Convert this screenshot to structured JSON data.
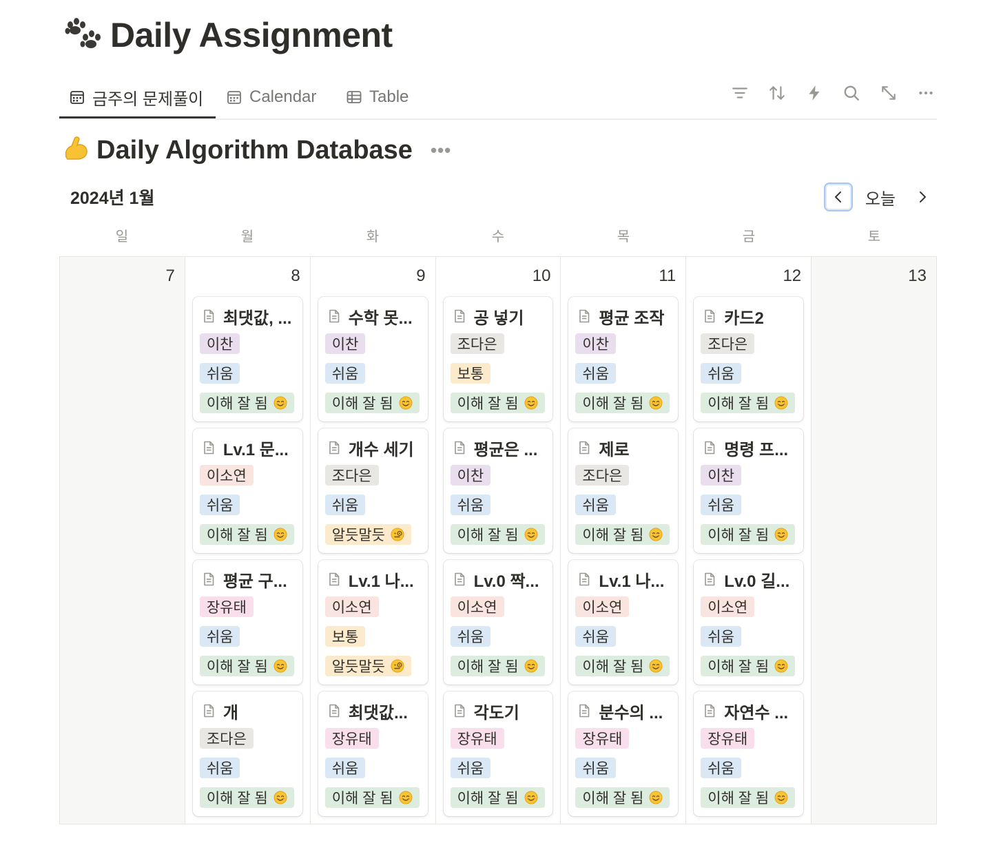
{
  "page": {
    "title": "Daily Assignment",
    "icon": "paw-prints-icon"
  },
  "tabs": [
    {
      "label": "금주의 문제풀이",
      "icon": "calendar-icon",
      "active": true
    },
    {
      "label": "Calendar",
      "icon": "calendar-icon",
      "active": false
    },
    {
      "label": "Table",
      "icon": "table-icon",
      "active": false
    }
  ],
  "toolbar": [
    "filter-icon",
    "sort-icon",
    "automation-lightning-icon",
    "search-icon",
    "expand-icon",
    "more-icon"
  ],
  "database": {
    "title": "Daily Algorithm Database",
    "icon": "flexed-biceps-icon",
    "more": "•••"
  },
  "calendar": {
    "month": "2024년 1월",
    "today_label": "오늘",
    "weekdays": [
      "일",
      "월",
      "화",
      "수",
      "목",
      "금",
      "토"
    ],
    "days": [
      {
        "num": "7",
        "weekend": true,
        "cards": []
      },
      {
        "num": "8",
        "weekend": false,
        "cards": [
          {
            "title": "최댓값, ...",
            "person": "이찬",
            "difficulty": "쉬움",
            "understanding": "이해 잘 됨"
          },
          {
            "title": "Lv.1 문...",
            "person": "이소연",
            "difficulty": "쉬움",
            "understanding": "이해 잘 됨"
          },
          {
            "title": "평균 구...",
            "person": "장유태",
            "difficulty": "쉬움",
            "understanding": "이해 잘 됨"
          },
          {
            "title": "개",
            "person": "조다은",
            "difficulty": "쉬움",
            "understanding": "이해 잘 됨"
          }
        ]
      },
      {
        "num": "9",
        "weekend": false,
        "cards": [
          {
            "title": "수학 못...",
            "person": "이찬",
            "difficulty": "쉬움",
            "understanding": "이해 잘 됨"
          },
          {
            "title": "개수 세기",
            "person": "조다은",
            "difficulty": "쉬움",
            "understanding": "알듯말듯"
          },
          {
            "title": "Lv.1 나...",
            "person": "이소연",
            "difficulty": "보통",
            "understanding": "알듯말듯"
          },
          {
            "title": "최댓값...",
            "person": "장유태",
            "difficulty": "쉬움",
            "understanding": "이해 잘 됨"
          }
        ]
      },
      {
        "num": "10",
        "weekend": false,
        "cards": [
          {
            "title": "공 넣기",
            "person": "조다은",
            "difficulty": "보통",
            "understanding": "이해 잘 됨"
          },
          {
            "title": "평균은 ...",
            "person": "이찬",
            "difficulty": "쉬움",
            "understanding": "이해 잘 됨"
          },
          {
            "title": "Lv.0 짝...",
            "person": "이소연",
            "difficulty": "쉬움",
            "understanding": "이해 잘 됨"
          },
          {
            "title": "각도기",
            "person": "장유태",
            "difficulty": "쉬움",
            "understanding": "이해 잘 됨"
          }
        ]
      },
      {
        "num": "11",
        "weekend": false,
        "cards": [
          {
            "title": "평균 조작",
            "person": "이찬",
            "difficulty": "쉬움",
            "understanding": "이해 잘 됨"
          },
          {
            "title": "제로",
            "person": "조다은",
            "difficulty": "쉬움",
            "understanding": "이해 잘 됨"
          },
          {
            "title": "Lv.1 나...",
            "person": "이소연",
            "difficulty": "쉬움",
            "understanding": "이해 잘 됨"
          },
          {
            "title": "분수의 ...",
            "person": "장유태",
            "difficulty": "쉬움",
            "understanding": "이해 잘 됨"
          }
        ]
      },
      {
        "num": "12",
        "weekend": false,
        "cards": [
          {
            "title": "카드2",
            "person": "조다은",
            "difficulty": "쉬움",
            "understanding": "이해 잘 됨"
          },
          {
            "title": "명령 프...",
            "person": "이찬",
            "difficulty": "쉬움",
            "understanding": "이해 잘 됨"
          },
          {
            "title": "Lv.0 길...",
            "person": "이소연",
            "difficulty": "쉬움",
            "understanding": "이해 잘 됨"
          },
          {
            "title": "자연수 ...",
            "person": "장유태",
            "difficulty": "쉬움",
            "understanding": "이해 잘 됨"
          }
        ]
      },
      {
        "num": "13",
        "weekend": true,
        "cards": []
      }
    ]
  },
  "tag_colors": {
    "이찬": "#e8deee",
    "이소연": "#f9e4df",
    "장유태": "#f9dfeb",
    "조다은": "#e8e7e4",
    "쉬움": "#d9e8f4",
    "보통": "#fbeacb",
    "이해 잘 됨": "#dcecdf",
    "알듯말듯": "#fbeacb"
  }
}
